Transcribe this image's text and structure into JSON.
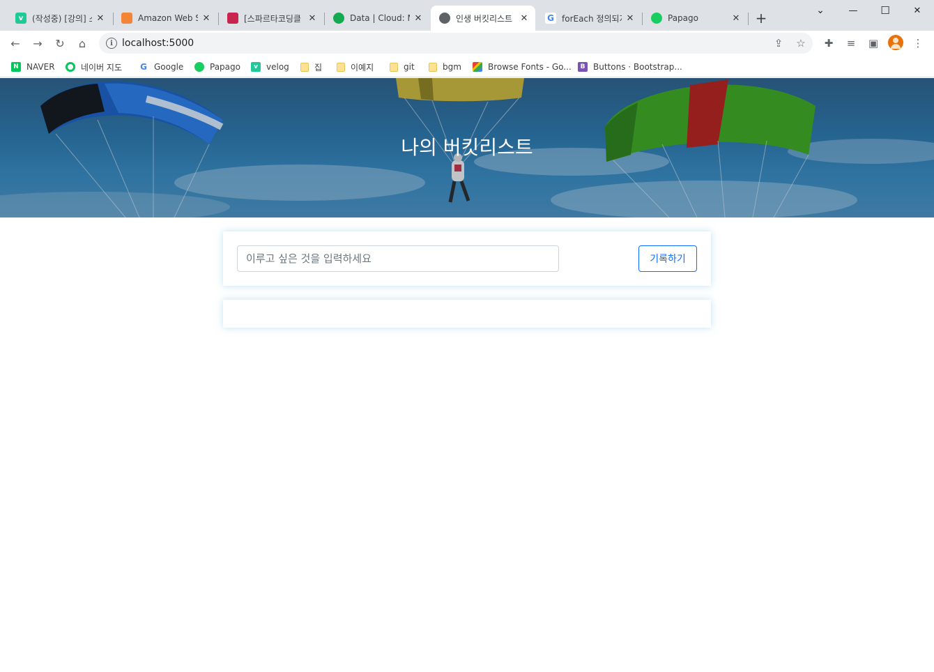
{
  "tabs": [
    {
      "label": "(작성중) [강의] 스",
      "icon": "velog-icon",
      "color": "#20c997",
      "glyph": "v"
    },
    {
      "label": "Amazon Web Se",
      "icon": "aws-icon",
      "color": "#f58536",
      "glyph": ""
    },
    {
      "label": "[스파르타코딩클",
      "icon": "sparta-icon",
      "color": "#c7254e",
      "glyph": ""
    },
    {
      "label": "Data | Cloud: M",
      "icon": "mongodb-icon",
      "color": "#13aa52",
      "glyph": ""
    },
    {
      "label": "인생 버킷리스트",
      "icon": "globe-icon",
      "color": "#5f6368",
      "glyph": ""
    },
    {
      "label": "forEach 정의되지",
      "icon": "google-icon",
      "color": "#4285f4",
      "glyph": "G"
    },
    {
      "label": "Papago",
      "icon": "papago-icon",
      "color": "#19ce60",
      "glyph": ""
    }
  ],
  "window": {
    "minimize": "—",
    "maximize": "☐",
    "close": "✕",
    "tab_search": "⌄",
    "new_tab": "+"
  },
  "address_bar": {
    "url": "localhost:5000"
  },
  "bookmarks": [
    {
      "label": "NAVER",
      "icon": "naver-icon",
      "color": "#03c75a",
      "glyph": "N"
    },
    {
      "label": "네이버 지도",
      "icon": "naver-map-icon",
      "color": "#03c75a",
      "glyph": ""
    },
    {
      "label": "Google",
      "icon": "google-icon",
      "color": "#4285f4",
      "glyph": "G"
    },
    {
      "label": "Papago",
      "icon": "papago-icon",
      "color": "#19ce60",
      "glyph": ""
    },
    {
      "label": "velog",
      "icon": "velog-icon",
      "color": "#20c997",
      "glyph": "v"
    },
    {
      "label": "집",
      "icon": "folder-icon",
      "color": "#fde293",
      "glyph": ""
    },
    {
      "label": "이예지",
      "icon": "folder-icon",
      "color": "#fde293",
      "glyph": ""
    },
    {
      "label": "git",
      "icon": "folder-icon",
      "color": "#fde293",
      "glyph": ""
    },
    {
      "label": "bgm",
      "icon": "folder-icon",
      "color": "#fde293",
      "glyph": ""
    },
    {
      "label": "Browse Fonts - Go...",
      "icon": "google-fonts-icon",
      "color": "#ea4335",
      "glyph": ""
    },
    {
      "label": "Buttons · Bootstrap...",
      "icon": "bootstrap-icon",
      "color": "#7952b3",
      "glyph": "B"
    }
  ],
  "page": {
    "title": "나의 버킷리스트",
    "input_placeholder": "이루고 싶은 것을 입력하세요",
    "save_button": "기록하기",
    "accent_color": "#0d6efd"
  }
}
